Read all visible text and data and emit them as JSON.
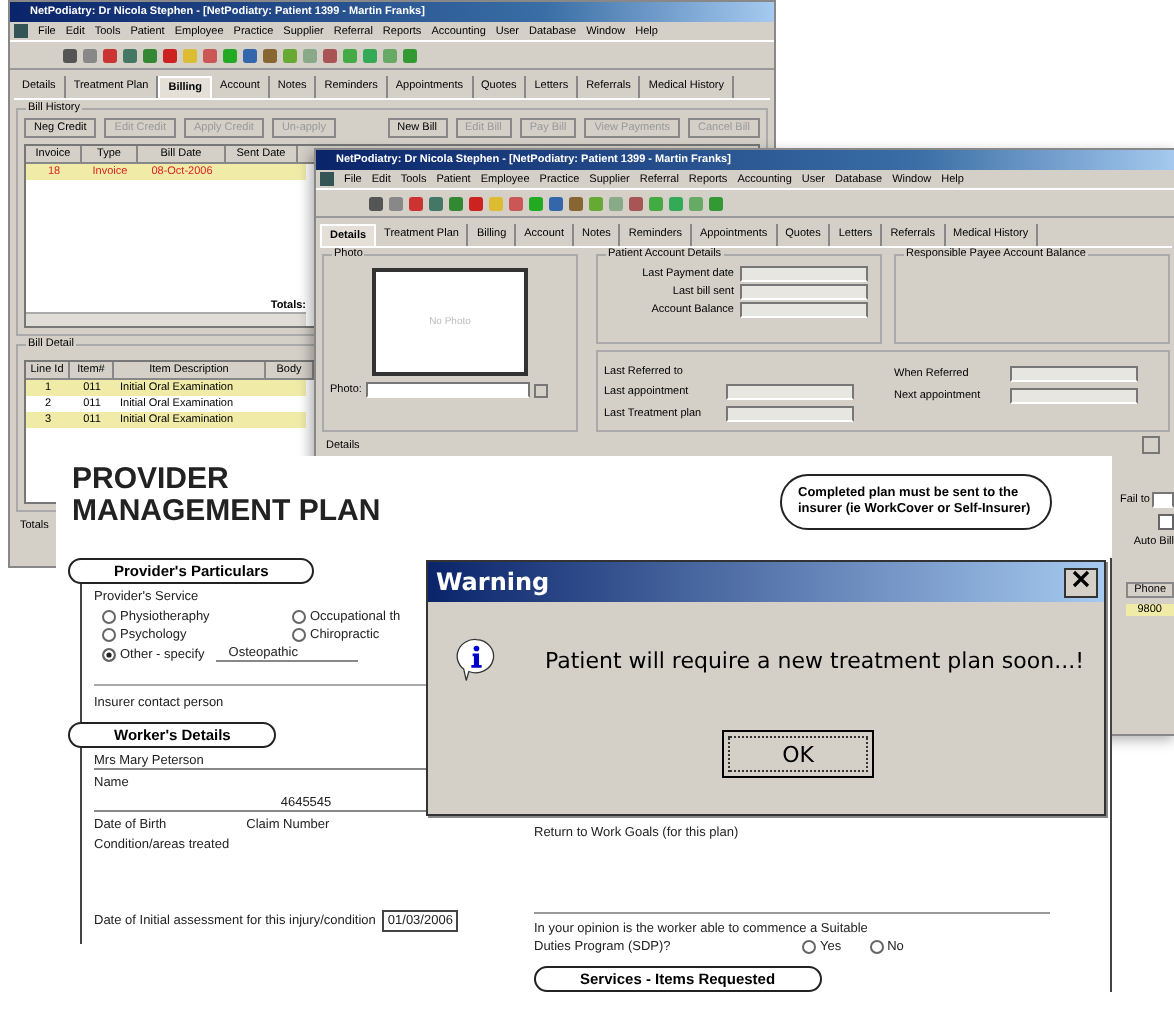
{
  "back_window": {
    "title": "NetPodiatry: Dr Nicola Stephen - [NetPodiatry: Patient 1399 - Martin Franks]",
    "menu": [
      "File",
      "Edit",
      "Tools",
      "Patient",
      "Employee",
      "Practice",
      "Supplier",
      "Referral",
      "Reports",
      "Accounting",
      "User",
      "Database",
      "Window",
      "Help"
    ],
    "tabs": [
      {
        "label": "Details",
        "selected": false
      },
      {
        "label": "Treatment Plan",
        "selected": false
      },
      {
        "label": "Billing",
        "selected": true
      },
      {
        "label": "Account",
        "selected": false
      },
      {
        "label": "Notes",
        "selected": false
      },
      {
        "label": "Reminders",
        "selected": false
      },
      {
        "label": "Appointments",
        "selected": false
      },
      {
        "label": "Quotes",
        "selected": false
      },
      {
        "label": "Letters",
        "selected": false
      },
      {
        "label": "Referrals",
        "selected": false
      },
      {
        "label": "Medical History",
        "selected": false
      }
    ],
    "bill_history": {
      "label": "Bill History",
      "buttons_left": [
        {
          "label": "Neg Credit",
          "disabled": false
        },
        {
          "label": "Edit Credit",
          "disabled": true
        },
        {
          "label": "Apply Credit",
          "disabled": true
        },
        {
          "label": "Un-apply",
          "disabled": true
        }
      ],
      "buttons_right": [
        {
          "label": "New Bill",
          "disabled": false
        },
        {
          "label": "Edit Bill",
          "disabled": true
        },
        {
          "label": "Pay Bill",
          "disabled": true
        },
        {
          "label": "View Payments",
          "disabled": true
        },
        {
          "label": "Cancel Bill",
          "disabled": true
        }
      ],
      "columns": [
        "Invoice",
        "Type",
        "Bill Date",
        "Sent Date"
      ],
      "rows": [
        {
          "cells": [
            "18",
            "Invoice",
            "08-Oct-2006",
            ""
          ],
          "selected": true
        }
      ],
      "totals_label": "Totals:"
    },
    "bill_detail": {
      "label": "Bill Detail",
      "columns": [
        "Line Id",
        "Item#",
        "Item Description",
        "Body"
      ],
      "rows": [
        {
          "cells": [
            "1",
            "011",
            "Initial Oral Examination",
            ""
          ],
          "selected": true
        },
        {
          "cells": [
            "2",
            "011",
            "Initial Oral Examination",
            ""
          ],
          "selected": false
        },
        {
          "cells": [
            "3",
            "011",
            "Initial Oral Examination",
            ""
          ],
          "selected": true
        }
      ]
    },
    "totals_label": "Totals"
  },
  "front_window": {
    "title": "NetPodiatry: Dr Nicola Stephen - [NetPodiatry: Patient 1399 - Martin Franks]",
    "menu": [
      "File",
      "Edit",
      "Tools",
      "Patient",
      "Employee",
      "Practice",
      "Supplier",
      "Referral",
      "Reports",
      "Accounting",
      "User",
      "Database",
      "Window",
      "Help"
    ],
    "tabs": [
      {
        "label": "Details",
        "selected": true
      },
      {
        "label": "Treatment Plan",
        "selected": false
      },
      {
        "label": "Billing",
        "selected": false
      },
      {
        "label": "Account",
        "selected": false
      },
      {
        "label": "Notes",
        "selected": false
      },
      {
        "label": "Reminders",
        "selected": false
      },
      {
        "label": "Appointments",
        "selected": false
      },
      {
        "label": "Quotes",
        "selected": false
      },
      {
        "label": "Letters",
        "selected": false
      },
      {
        "label": "Referrals",
        "selected": false
      },
      {
        "label": "Medical History",
        "selected": false
      }
    ],
    "photo": {
      "label": "Photo",
      "placeholder_text": "No Photo",
      "field_label": "Photo:"
    },
    "account": {
      "label": "Patient Account Details",
      "fields": [
        "Last Payment date",
        "Last bill sent",
        "Account Balance"
      ]
    },
    "payee": {
      "label": "Responsible Payee Account Balance"
    },
    "referral": {
      "left_fields": [
        "Last Referred to",
        "Last appointment",
        "Last Treatment plan"
      ],
      "right_fields": [
        "When Referred",
        "Next appointment"
      ]
    },
    "details_label": "Details",
    "side": {
      "fail_label": "Fail to",
      "auto_bill": {
        "label": "Auto Bill",
        "checked": false
      },
      "phone_column": "Phone",
      "phone_value": "9800"
    }
  },
  "form": {
    "title_lines": [
      "PROVIDER",
      "MANAGEMENT PLAN"
    ],
    "callout": "Completed plan must be sent to the insurer (ie WorkCover or Self-Insurer)",
    "provider_section": "Provider's Particulars",
    "service_label": "Provider's Service",
    "services": [
      {
        "label": "Physiotheraphy",
        "selected": false
      },
      {
        "label": "Occupational th",
        "selected": false
      },
      {
        "label": "Psychology",
        "selected": false
      },
      {
        "label": "Chiropractic",
        "selected": false
      },
      {
        "label": "Other - specify",
        "selected": true
      }
    ],
    "other_value": "Osteopathic",
    "insurer_contact": "Insurer contact person",
    "worker_section": "Worker's Details",
    "worker_name": "Mrs Mary Peterson",
    "name_label": "Name",
    "claim_value": "4645545",
    "dob_label": "Date of Birth",
    "claim_label": "Claim Number",
    "condition_label": "Condition/areas treated",
    "assessment_label": "Date of Initial assessment for this injury/condition",
    "assessment_value": "01/03/2006",
    "goals_label": "Return to Work Goals (for this plan)",
    "sdp_question": [
      "In your opinion is the worker able to commence a Suitable",
      "Duties Program (SDP)?"
    ],
    "sdp_options": [
      {
        "label": "Yes",
        "selected": false
      },
      {
        "label": "No",
        "selected": false
      }
    ],
    "services_section": "Services - Items Requested"
  },
  "dialog": {
    "title": "Warning",
    "message": "Patient will require a new treatment plan soon...!",
    "button": "OK"
  }
}
